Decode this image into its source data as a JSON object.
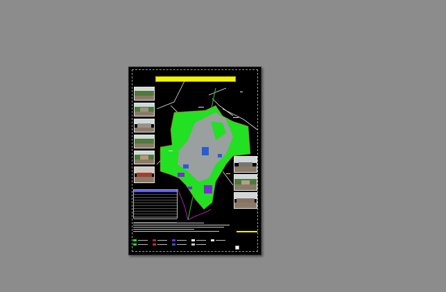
{
  "viewer": {
    "background_color": "#8c8c8c"
  },
  "sheet": {
    "title": "",
    "background_color": "#000000",
    "accent_color": "#f4f400",
    "photos_left": [
      {
        "name": "photo-1"
      },
      {
        "name": "photo-2"
      },
      {
        "name": "photo-3"
      },
      {
        "name": "photo-4"
      },
      {
        "name": "photo-5"
      },
      {
        "name": "photo-6"
      }
    ],
    "photos_right": [
      {
        "name": "photo-7"
      },
      {
        "name": "photo-8"
      },
      {
        "name": "photo-9"
      }
    ],
    "map_colors": {
      "green_zone": "#22e022",
      "urban": "#9aa0a0",
      "blue_zone": "#2a5bd6",
      "purple_zone": "#7b2bd6",
      "boundary": "#ff2a2a",
      "secondary_boundary": "#d62bd6",
      "road": "#e6e6e6",
      "highway": "#33cc33"
    }
  }
}
